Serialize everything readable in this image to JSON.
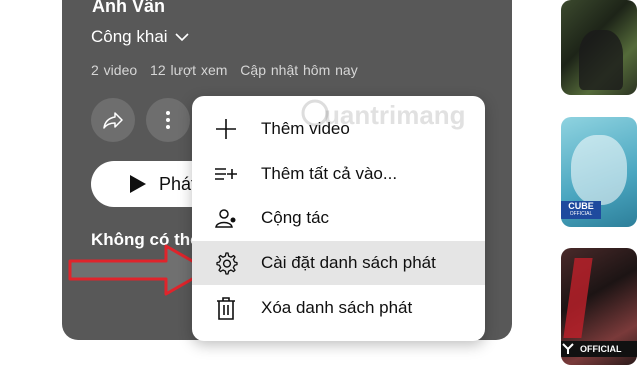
{
  "playlist": {
    "title": "Anh Vân",
    "visibility": "Công khai",
    "video_count": "2 video",
    "views": "12 lượt xem",
    "updated": "Cập nhật hôm nay",
    "play_label": "Phát",
    "description": "Không có thô"
  },
  "menu": {
    "items": [
      {
        "label": "Thêm video",
        "icon": "plus-icon"
      },
      {
        "label": "Thêm tất cả vào...",
        "icon": "playlist-add-icon"
      },
      {
        "label": "Cộng tác",
        "icon": "collaborate-icon"
      },
      {
        "label": "Cài đặt danh sách phát",
        "icon": "gear-icon"
      },
      {
        "label": "Xóa danh sách phát",
        "icon": "trash-icon"
      }
    ]
  },
  "thumbnails": {
    "badge_cube_line1": "CUBE",
    "badge_cube_line2": "OFFICIAL",
    "badge_official": "OFFICIAL"
  },
  "watermark": "uantrimang",
  "colors": {
    "panel": "#585858",
    "highlight": "#e5e5e5",
    "arrow": "#e0242b"
  }
}
